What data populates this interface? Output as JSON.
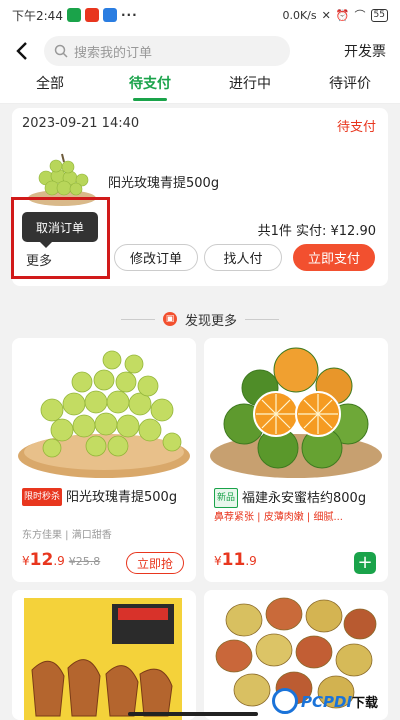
{
  "status_bar": {
    "time": "下午2:44",
    "network": "0.0K/s",
    "battery": "55"
  },
  "header": {
    "back_icon": "back-arrow-icon",
    "search_placeholder": "搜索我的订单",
    "invoice_label": "开发票"
  },
  "tabs": [
    {
      "label": "全部",
      "active": false
    },
    {
      "label": "待支付",
      "active": true
    },
    {
      "label": "进行中",
      "active": false
    },
    {
      "label": "待评价",
      "active": false
    }
  ],
  "order": {
    "date": "2023-09-21 14:40",
    "status": "待支付",
    "product_name": "阳光玫瑰青提500g",
    "total_text": "共1件 实付: ¥12.90",
    "more_label": "更多",
    "popup_label": "取消订单",
    "buttons": {
      "modify": "修改订单",
      "find_payer": "找人付",
      "pay_now": "立即支付"
    }
  },
  "discover": {
    "title": "发现更多"
  },
  "products": [
    {
      "tag": "限时秒杀",
      "title": "阳光玫瑰青提500g",
      "sub": "东方佳果 | 满口甜香",
      "price_main": "12",
      "price_dec": ".9",
      "old_price": "¥25.8",
      "buy_label": "立即抢"
    },
    {
      "tag": "新品",
      "title": "福建永安蜜桔约800g",
      "sub": "鼻荐紧张 | 皮薄肉嫩 | 细腻...",
      "price_main": "11",
      "price_dec": ".9",
      "add_label": "+"
    }
  ],
  "watermark": {
    "brand": "PCPDI",
    "suffix": "下载"
  },
  "colors": {
    "accent_green": "#1aa34a",
    "accent_red": "#e8361e",
    "pay_button": "#f2502f",
    "highlight_box": "#d11a1a"
  }
}
